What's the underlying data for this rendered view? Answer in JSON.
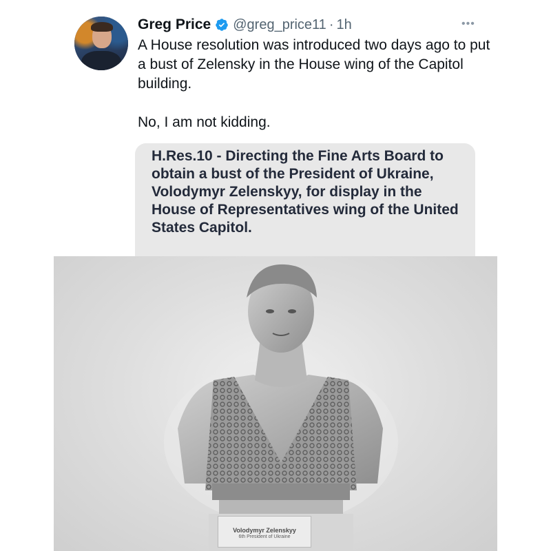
{
  "tweet": {
    "author_name": "Greg Price",
    "handle": "@greg_price11",
    "separator": "·",
    "time": "1h",
    "more": "•••",
    "text_p1": "A House resolution was introduced two days ago to put a bust of Zelensky in the House wing of the Capitol building.",
    "text_p2": "No, I am not kidding."
  },
  "card": {
    "title": "H.Res.10 - Directing the Fine Arts Board to obtain a bust of the President of Ukraine, Volodymyr Zelenskyy, for display in the House of Representatives wing of the United States Capitol."
  },
  "image": {
    "plaque_name": "Volodymyr Zelenskyy",
    "plaque_subtitle": "6th President of Ukraine"
  },
  "colors": {
    "verified": "#1d9bf0",
    "text_primary": "#0f1419",
    "text_secondary": "#536471",
    "card_bg": "#e8e8e8"
  },
  "icons": {
    "verified": "verified-badge-icon",
    "more": "more-options-icon"
  }
}
